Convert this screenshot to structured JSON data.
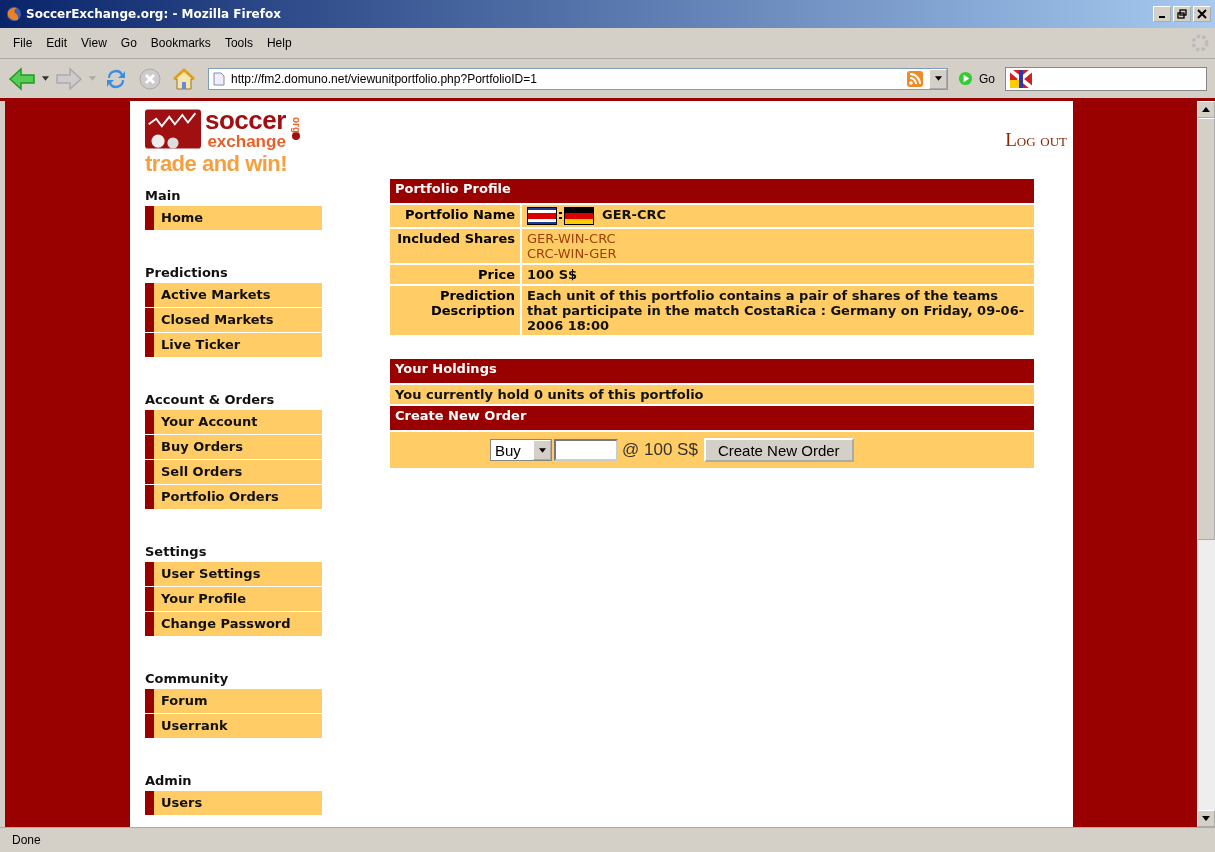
{
  "window": {
    "title": "SoccerExchange.org: - Mozilla Firefox"
  },
  "menu": [
    "File",
    "Edit",
    "View",
    "Go",
    "Bookmarks",
    "Tools",
    "Help"
  ],
  "toolbar": {
    "url": "http://fm2.domuno.net/viewunitportfolio.php?PortfolioID=1",
    "go": "Go"
  },
  "logo": {
    "word1": "soccer",
    "word2": "exchange",
    "org": "org",
    "slogan": "trade and win!"
  },
  "logout": "Log out",
  "sidebar": [
    {
      "title": "Main",
      "items": [
        {
          "label": "Home"
        }
      ]
    },
    {
      "title": "Predictions",
      "items": [
        {
          "label": "Active Markets"
        },
        {
          "label": "Closed Markets"
        },
        {
          "label": "Live Ticker"
        }
      ]
    },
    {
      "title": "Account & Orders",
      "items": [
        {
          "label": "Your Account"
        },
        {
          "label": "Buy Orders"
        },
        {
          "label": "Sell Orders"
        },
        {
          "label": "Portfolio Orders"
        }
      ]
    },
    {
      "title": "Settings",
      "items": [
        {
          "label": "User Settings"
        },
        {
          "label": "Your Profile"
        },
        {
          "label": "Change Password"
        }
      ]
    },
    {
      "title": "Community",
      "items": [
        {
          "label": "Forum"
        },
        {
          "label": "Userrank"
        }
      ]
    },
    {
      "title": "Admin",
      "items": [
        {
          "label": "Users"
        }
      ]
    }
  ],
  "portfolio_profile": {
    "title": "Portfolio Profile",
    "rows": [
      {
        "label": "Portfolio Name",
        "kind": "flags",
        "value": "GER-CRC"
      },
      {
        "label": "Included Shares",
        "kind": "links",
        "links": [
          "GER-WIN-CRC",
          "CRC-WIN-GER"
        ]
      },
      {
        "label": "Price",
        "kind": "text",
        "value": "100 S$"
      },
      {
        "label": "Prediction Description",
        "kind": "text",
        "value": "Each unit of this portfolio contains a pair of shares of the teams that participate in the match CostaRica : Germany on Friday, 09-06-2006 18:00"
      }
    ]
  },
  "holdings": {
    "title": "Your Holdings",
    "text": "You currently hold 0 units of this portfolio"
  },
  "create_order": {
    "title": "Create New Order",
    "side": "Buy",
    "price": "@ 100 S$",
    "button": "Create New Order"
  },
  "status_bar": "Done"
}
